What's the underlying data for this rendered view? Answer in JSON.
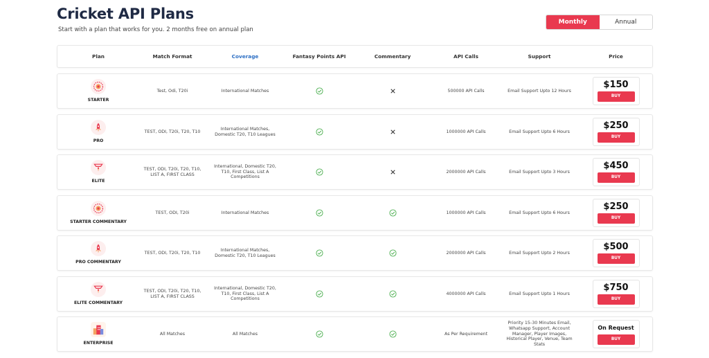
{
  "page": {
    "title": "Cricket API Plans",
    "subtitle": "Start with a plan that works for you. 2 months free on annual plan"
  },
  "billing_toggle": {
    "options": [
      "Monthly",
      "Annual"
    ],
    "selected": "Monthly"
  },
  "colors": {
    "accent": "#e9394f",
    "check": "#4caf50",
    "link": "#2d6fc4"
  },
  "table": {
    "headers": {
      "plan": "Plan",
      "format": "Match Format",
      "coverage": "Coverage",
      "fantasy": "Fantasy Points API",
      "commentary": "Commentary",
      "calls": "API Calls",
      "support": "Support",
      "price": "Price"
    },
    "buy_label": "BUY",
    "rows": [
      {
        "name": "STARTER",
        "icon": "target-badge-icon",
        "format": "Test, Odi, T20i",
        "coverage": "International Matches",
        "fantasy": true,
        "commentary": false,
        "calls": "500000 API Calls",
        "support": "Email Support Upto 12 Hours",
        "price": "$150"
      },
      {
        "name": "PRO",
        "icon": "rocket-icon",
        "format": "TEST, ODI, T20i, T20, T10",
        "coverage": "International Matches, Domestic T20, T10 Leagues",
        "fantasy": true,
        "commentary": false,
        "calls": "1000000 API Calls",
        "support": "Email Support Upto 6 Hours",
        "price": "$250"
      },
      {
        "name": "ELITE",
        "icon": "crown-icon",
        "format": "TEST, ODI, T20i, T20, T10, LIST A, FIRST CLASS",
        "coverage": "International, Domestic T20, T10, First Class, List A Competitions",
        "fantasy": true,
        "commentary": false,
        "calls": "2000000 API Calls",
        "support": "Email Support Upto 3 Hours",
        "price": "$450"
      },
      {
        "name": "STARTER COMMENTARY",
        "icon": "target-badge-icon",
        "format": "TEST, ODI, T20i",
        "coverage": "International Matches",
        "fantasy": true,
        "commentary": true,
        "calls": "1000000 API Calls",
        "support": "Email Support Upto 6 Hours",
        "price": "$250"
      },
      {
        "name": "PRO COMMENTARY",
        "icon": "rocket-icon",
        "format": "TEST, ODI, T20i, T20, T10",
        "coverage": "International Matches, Domestic T20, T10 Leagues",
        "fantasy": true,
        "commentary": true,
        "calls": "2000000 API Calls",
        "support": "Email Support Upto 2 Hours",
        "price": "$500"
      },
      {
        "name": "ELITE COMMENTARY",
        "icon": "crown-icon",
        "format": "TEST, ODI, T20i, T20, T10, LIST A, FIRST CLASS",
        "coverage": "International, Domestic T20, T10, First Class, List A Competitions",
        "fantasy": true,
        "commentary": true,
        "calls": "4000000 API Calls",
        "support": "Email Support Upto 1 Hours",
        "price": "$750"
      },
      {
        "name": "ENTERPRISE",
        "icon": "buildings-icon",
        "format": "All Matches",
        "coverage": "All Matches",
        "fantasy": true,
        "commentary": true,
        "calls": "As Per Requirement",
        "support": "Priority 15-30 Minutes Email, Whatsapp Support, Account Manager, Player Images, Historical Player, Venue, Team Stats",
        "price": "On Request"
      }
    ]
  }
}
